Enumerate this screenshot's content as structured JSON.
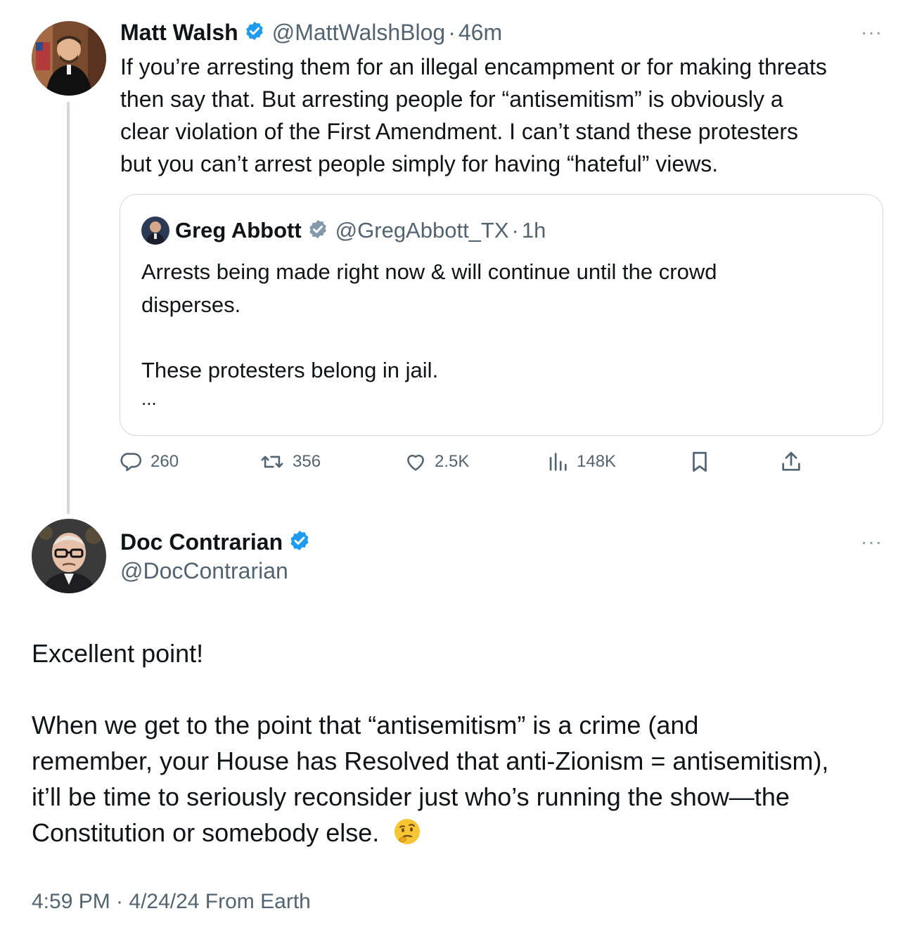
{
  "tweet1": {
    "author_name": "Matt Walsh",
    "author_handle": "@MattWalshBlog",
    "separator": "·",
    "time": "46m",
    "more_glyph": "···",
    "lines": [
      "If you’re arresting them for an illegal encampment or for making threats",
      "then say that. But arresting people for “antisemitism” is obviously a",
      "clear violation of the First Amendment. I can’t stand these protesters",
      "but you can’t arrest people simply for having “hateful” views."
    ],
    "verified_color": "#1d9bf0"
  },
  "quote": {
    "author_name": "Greg Abbott",
    "author_handle": "@GregAbbott_TX",
    "separator": "·",
    "time": "1h",
    "verified_color": "#829aab",
    "lines": [
      "Arrests being made right now & will continue until the crowd",
      "disperses.",
      "These protesters belong in jail.",
      "..."
    ]
  },
  "actions": {
    "replies": "260",
    "reposts": "356",
    "likes": "2.5K",
    "views": "148K",
    "icons": [
      "reply-icon",
      "repost-icon",
      "like-icon",
      "views-icon",
      "bookmark-icon",
      "share-icon"
    ]
  },
  "tweet2": {
    "author_name": "Doc Contrarian",
    "author_handle": "@DocContrarian",
    "more_glyph": "···",
    "verified_color": "#1d9bf0",
    "paragraph1": "Excellent point!",
    "lines": [
      "When we get to the point that “antisemitism” is a crime (and",
      "remember, your House has Resolved that anti-Zionism = antisemitism),",
      "it’ll be time to seriously reconsider just who’s running the show—the",
      "Constitution or somebody else."
    ],
    "emoji": "🤔",
    "timestamp": "4:59 PM · 4/24/24 From Earth"
  }
}
